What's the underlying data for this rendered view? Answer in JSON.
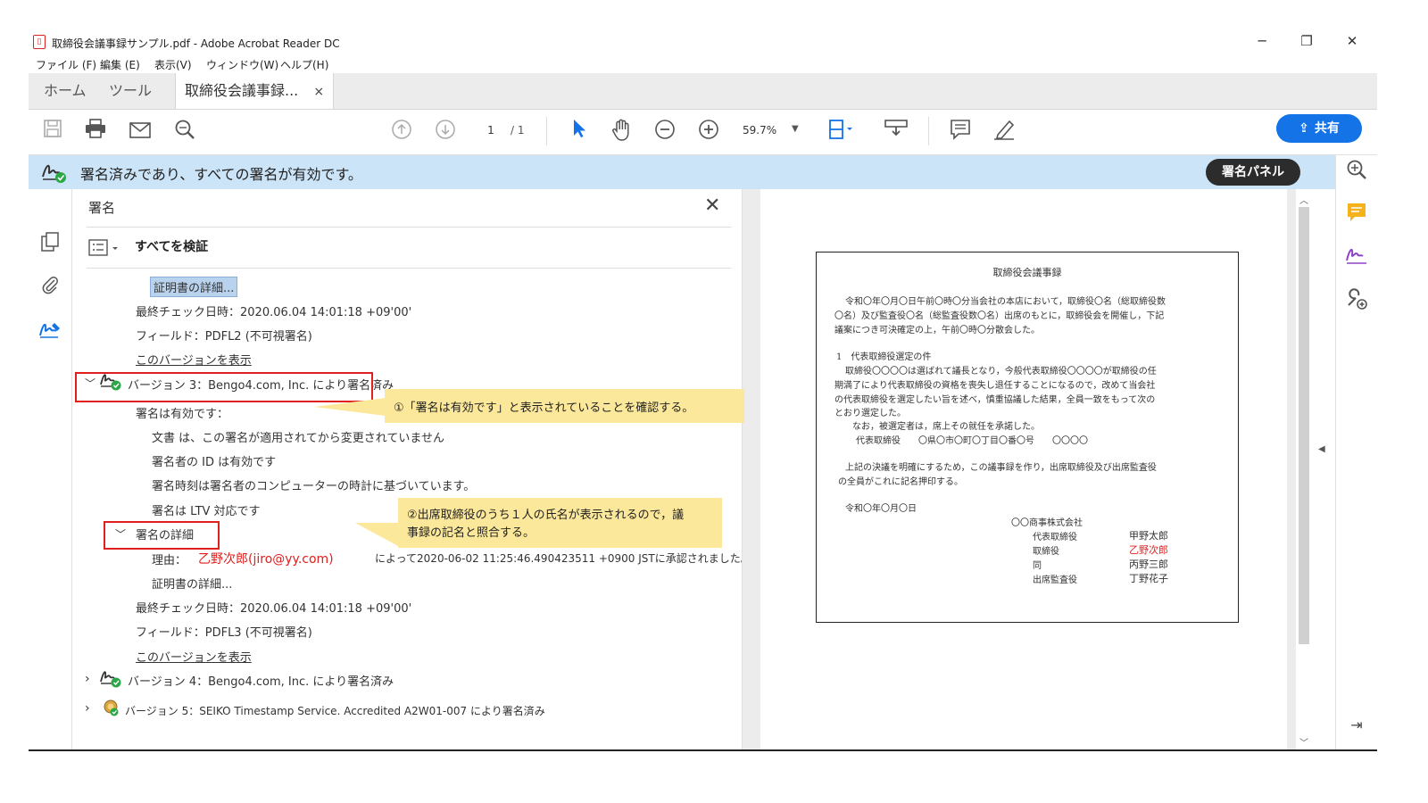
{
  "window": {
    "title": "取締役会議事録サンプル.pdf - Adobe Acrobat Reader DC",
    "file_icon": "pdf-file-icon",
    "controls": {
      "minimize": "─",
      "restore": "❐",
      "close": "✕"
    }
  },
  "menu": [
    "ファイル (F)",
    "編集 (E)",
    "表示(V)",
    "ウィンドウ(W)",
    "ヘルプ(H)"
  ],
  "tabs": {
    "home": "ホーム",
    "tools": "ツール",
    "document": "取締役会議事録...",
    "close": "×"
  },
  "toolbar": {
    "page_current": "1",
    "page_total": "/ 1",
    "zoom": "59.7%",
    "share_label": "共有"
  },
  "signature_bar": {
    "message": "署名済みであり、すべての署名が有効です。",
    "panel_button": "署名パネル"
  },
  "sig_panel": {
    "title": "署名",
    "verify_all": "すべてを検証",
    "rows": {
      "cert_details_top": "証明書の詳細...",
      "last_check_1": "最終チェック日時：2020.06.04 14:01:18 +09'00'",
      "field_1": "フィールド：PDFL2 (不可視署名)",
      "view_version_1": "このバージョンを表示",
      "version3": "バージョン 3：Bengo4.com, Inc. により署名済み",
      "sig_valid": "署名は有効です：",
      "detail_unchanged": "文書 は、この署名が適用されてから変更されていません",
      "detail_id": "署名者の ID は有効です",
      "detail_time": "署名時刻は署名者のコンピューターの時計に基づいています。",
      "detail_ltv": "署名は LTV 対応です",
      "sig_details": "署名の詳細",
      "reason_label": "理由：",
      "reason_name": "乙野次郎(jiro@yy.com)",
      "reason_suffix": "によって2020-06-02 11:25:46.490423511 +0900 JSTに承認されました。",
      "cert_details_2": "証明書の詳細...",
      "last_check_2": "最終チェック日時：2020.06.04 14:01:18 +09'00'",
      "field_2": "フィールド：PDFL3 (不可視署名)",
      "view_version_2": "このバージョンを表示",
      "version4": "バージョン 4：Bengo4.com, Inc. により署名済み",
      "version5": "バージョン 5：SEIKO Timestamp Service. Accredited A2W01-007 により署名済み"
    }
  },
  "callouts": {
    "first": "①「署名は有効です」と表示されていることを確認する。",
    "second_line1": "②出席取締役のうち１人の氏名が表示されるので，議",
    "second_line2": "事録の記名と照合する。"
  },
  "document": {
    "heading": "取締役会議事録",
    "p1_l1": "令和〇年〇月〇日午前〇時〇分当会社の本店において，取締役〇名（総取締役数",
    "p1_l2": "〇名）及び監査役〇名（総監査役数〇名）出席のもとに，取締役会を開催し，下記",
    "p1_l3": "議案につき可決確定の上，午前〇時〇分散会した。",
    "item_title": "1　代表取締役選定の件",
    "p2_l1": "取締役〇〇〇〇は選ばれて議長となり，今般代表取締役〇〇〇〇が取締役の任",
    "p2_l2": "期満了により代表取締役の資格を喪失し退任することになるので，改めて当会社",
    "p2_l3": "の代表取締役を選定したい旨を述べ，慎重協議した結果，全員一致をもって次の",
    "p2_l4": "とおり選定した。",
    "p2_l5": "なお，被選定者は，席上その就任を承諾した。",
    "rep_line": "代表取締役　　〇県〇市〇町〇丁目〇番〇号　　〇〇〇〇",
    "p3_l1": "上記の決議を明確にするため，この議事録を作り，出席取締役及び出席監査役",
    "p3_l2": "の全員がこれに記名押印する。",
    "date": "令和〇年〇月〇日",
    "company": "〇〇商事株式会社",
    "signers": [
      {
        "role": "代表取締役",
        "name": "甲野太郎",
        "highlight": false
      },
      {
        "role": "取締役",
        "name": "乙野次郎",
        "highlight": true
      },
      {
        "role": "同",
        "name": "丙野三郎",
        "highlight": false
      },
      {
        "role": "出席監査役",
        "name": "丁野花子",
        "highlight": false
      }
    ]
  },
  "colors": {
    "accent": "#1473e6",
    "sig_bar": "#cce4f7",
    "highlight_red": "#e0201e",
    "callout": "#fce89a",
    "valid_green": "#2aa845"
  }
}
